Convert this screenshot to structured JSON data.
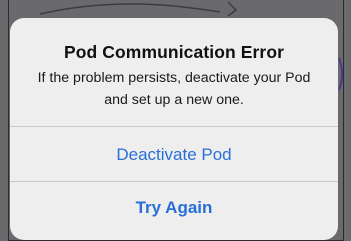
{
  "alert": {
    "title": "Pod Communication Error",
    "message": "If the problem persists, deactivate your Pod and set up a new one.",
    "actions": [
      {
        "label": "Deactivate Pod"
      },
      {
        "label": "Try Again"
      }
    ]
  },
  "colors": {
    "alert_background": "#eeeeef",
    "action_text": "#2a6fd6",
    "dimmed_background": "#6a6a6c"
  }
}
